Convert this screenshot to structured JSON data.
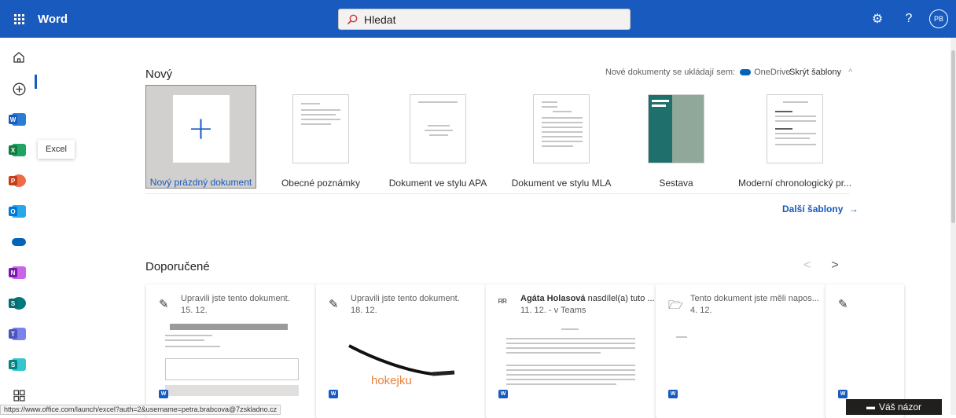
{
  "topbar": {
    "app_name": "Word",
    "search_placeholder": "Hledat",
    "avatar_initials": "PB",
    "help": "?"
  },
  "rail": {
    "tooltip": "Excel"
  },
  "new_section": {
    "title": "Nový",
    "save_note": "Nové dokumenty se ukládají sem:",
    "save_location": "OneDrive",
    "hide_templates": "Skrýt šablony",
    "more_templates": "Další šablony",
    "templates": [
      {
        "label": "Nový prázdný dokument"
      },
      {
        "label": "Obecné poznámky"
      },
      {
        "label": "Dokument ve stylu APA"
      },
      {
        "label": "Dokument ve stylu MLA"
      },
      {
        "label": "Sestava"
      },
      {
        "label": "Moderní chronologický pr..."
      }
    ]
  },
  "recommended": {
    "title": "Doporučené",
    "cards": [
      {
        "line1": "Upravili jste tento dokument.",
        "line2": "15. 12."
      },
      {
        "line1": "Upravili jste tento dokument.",
        "line2": "18. 12.",
        "preview_text": "hokejku"
      },
      {
        "author": "Agáta Holasová",
        "line1": " nasdílel(a) tuto ...",
        "line2": "11. 12. - v Teams"
      },
      {
        "line1": "Tento dokument jste měli napos...",
        "line2": "4. 12."
      }
    ]
  },
  "status_url": "https://www.office.com/launch/excel?auth=2&username=petra.brabcova@7zskladno.cz",
  "feedback": "Váš názor",
  "colors": {
    "brand": "#185abd"
  }
}
